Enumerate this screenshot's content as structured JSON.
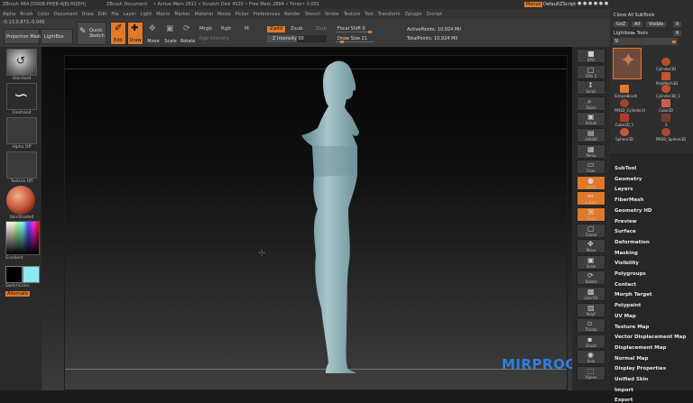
{
  "titlebar": {
    "app": "ZBrush 4R4 [DXKB-PHEB-AJEJ-HQDH]",
    "doc": "ZBrush Document",
    "stats": "• Active Mem 2811 • Scratch Disk 4520 • Free Mem 2884 • Timer• 0.001",
    "menus_label": "Menus",
    "script_label": "DefaultZScript"
  },
  "menubar": {
    "items": [
      "Alpha",
      "Brush",
      "Color",
      "Document",
      "Draw",
      "Edit",
      "File",
      "Layer",
      "Light",
      "Macro",
      "Marker",
      "Material",
      "Movie",
      "Picker",
      "Preferences",
      "Render",
      "Stencil",
      "Stroke",
      "Texture",
      "Tool",
      "Transform",
      "Zplugin",
      "Zscript"
    ]
  },
  "toolbar": {
    "coords": "-0.13,0.873,-0.045",
    "projection_master": "Projection Master",
    "lightbox": "LightBox",
    "quick_sketch": "Quick Sketch",
    "edit": "Edit",
    "draw": "Draw",
    "move": "Move",
    "scale": "Scale",
    "rotate": "Rotate",
    "mrgb": "Mrgb",
    "rgb": "Rgb",
    "m": "M",
    "rgb_intensity": "Rgb Intensity",
    "zadd": "Zadd",
    "zsub": "Zsub",
    "zcut": "Zcut",
    "z_intensity": "Z Intensity 50",
    "focal_shift": "Focal Shift 0",
    "draw_size": "Draw Size 21",
    "active_points": "ActivePoints: 10,924 Mil",
    "total_points": "TotalPoints: 10,924 Mil",
    "z_intensity_level": 0.5,
    "draw_size_level": 0.12
  },
  "leftshelf": {
    "brush_label": "Standard",
    "stroke_label": "Freehand",
    "alpha_label": "Alpha Off",
    "texture_label": "Texture Off",
    "material_label": "SkinShade4",
    "gradient_label": "Gradient",
    "switchcolor_label": "SwitchColor",
    "alternate_label": "Alternate"
  },
  "rightshelf": {
    "items": [
      "BPR",
      "SPix 3",
      "Scroll",
      "Zoom",
      "Actual",
      "AAHalf",
      "Persp",
      "Floor",
      "Local",
      "L.Sym",
      "Gxyz",
      "Frame",
      "Move",
      "Scale",
      "Rotate",
      "Line Fill",
      "PolyF",
      "Transp",
      "Ghost",
      "Solo",
      "Xpose"
    ]
  },
  "tray": {
    "clone_all": "Clone All SubTools",
    "goz": "GoZ",
    "all": "All",
    "visible": "Visible",
    "r": "R",
    "lightbox_tools": "Lightbox▸ Tools",
    "tool_slider": "SI",
    "subtools": [
      "Cylinder3D",
      "PolyMesh3D",
      "SimpleBrush",
      "Cylinder3D_1",
      "PM3D_Cylinder3I",
      "Cube3D",
      "Cube3D_1",
      "3",
      "Sphere3D",
      "PM3D_Sphere3D"
    ],
    "menu": [
      "SubTool",
      "Geometry",
      "Layers",
      "FiberMesh",
      "Geometry HD",
      "Preview",
      "Surface",
      "Deformation",
      "Masking",
      "Visibility",
      "Polygroups",
      "Contact",
      "Morph Target",
      "Polypaint",
      "UV Map",
      "Texture Map",
      "Vector Displacement Map",
      "Displacement Map",
      "Normal Map",
      "Display Properties",
      "Unified Skin",
      "Import",
      "Export"
    ]
  },
  "watermark": "MIRPROGRAMM.RU",
  "colors": {
    "accent": "#e07a2a",
    "cyan": "#8fe9f2",
    "figure": "#8fb2b8"
  }
}
